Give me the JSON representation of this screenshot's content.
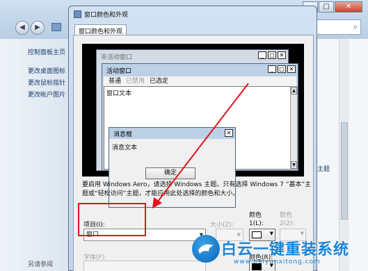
{
  "bg_window": {
    "nav_back": "◀",
    "nav_forward": "▶",
    "window_buttons": [
      "─",
      "□",
      "✕"
    ],
    "search_glyph": "⌕",
    "help_glyph": "?",
    "sidebar": {
      "home": "控制面板主页",
      "links": [
        "更改桌面图标",
        "更改鼠标指针",
        "更改帐户图片"
      ],
      "see_also": "另请参阅"
    },
    "partial_link": "主题"
  },
  "dialog": {
    "title": "窗口颜色和外观",
    "tab": "窗口颜色和外观",
    "preview": {
      "inactive_title": "非活动窗口",
      "active_title": "活动窗口",
      "caption_buttons": [
        "_",
        "□",
        "✕"
      ],
      "menu": {
        "normal": "普通",
        "disabled": "已禁用",
        "selected": "已选定"
      },
      "window_text": "窗口文本",
      "msgbox_title": "消息框",
      "msgbox_text": "消息文本",
      "ok": "确定",
      "scroll_up": "▲",
      "scroll_down": "▼"
    },
    "info": "要启用 Windows Aero，请选择 Windows 主题。只有选择 Windows 7 “基本”主题或“轻松访问”主题，才能应用此处选择的颜色和大小。",
    "item_label": "项目(I):",
    "item_value": "窗口",
    "size_label": "大小(Z):",
    "color1_label": "颜色 1(L):",
    "color2_label": "颜色 2(2):",
    "font_label": "字体(F):",
    "font_color_label": "颜色(R):",
    "dropdown_arrow": "▼"
  },
  "watermark": {
    "brand": "白云一键重装系统",
    "url": "www.baiyunxitong.com"
  },
  "colors": {
    "highlight": "#e3131b",
    "arrow": "#e3131b",
    "title_bar": "#bcd0e6",
    "watermark": "#1b84d6"
  }
}
